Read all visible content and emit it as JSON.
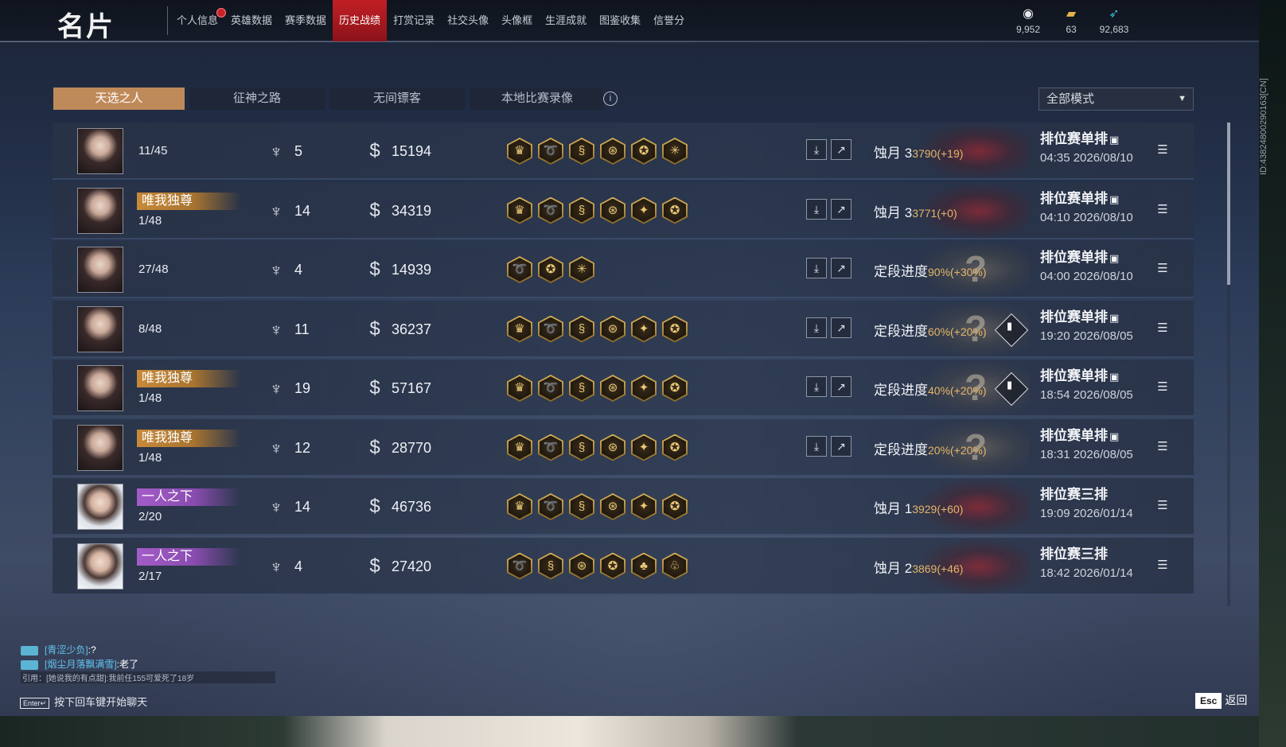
{
  "app": {
    "title": "名片"
  },
  "nav": {
    "items": [
      {
        "label": "个人信息",
        "badge": true
      },
      {
        "label": "英雄数据"
      },
      {
        "label": "赛季数据"
      },
      {
        "label": "历史战绩",
        "active": true
      },
      {
        "label": "打赏记录"
      },
      {
        "label": "社交头像"
      },
      {
        "label": "头像框"
      },
      {
        "label": "生涯成就"
      },
      {
        "label": "图鉴收集"
      },
      {
        "label": "信誉分"
      }
    ]
  },
  "currencies": [
    {
      "icon": "coin-eye-icon",
      "value": "9,952"
    },
    {
      "icon": "ticket-icon",
      "value": "63"
    },
    {
      "icon": "feather-icon",
      "value": "92,683"
    }
  ],
  "tabs": [
    {
      "label": "天选之人",
      "active": true
    },
    {
      "label": "征神之路"
    },
    {
      "label": "无间镖客"
    },
    {
      "label": "本地比赛录像"
    }
  ],
  "mode_filter": {
    "selected": "全部模式"
  },
  "side_id": "ID:4382480029016​3[CN]",
  "matches": [
    {
      "avatar": "female",
      "title": "",
      "title_style": "",
      "rank": "11/45",
      "kills": "5",
      "damage": "15194",
      "medals": [
        "♛",
        "➰",
        "§",
        "⊛",
        "✪",
        "✳"
      ],
      "replay": true,
      "result_label": "蚀月 3",
      "result_delta": "3790(+19)",
      "emblem": "red",
      "trend": false,
      "mode": "排位赛单排",
      "mode_icon": true,
      "time": "04:35  2026/08/10"
    },
    {
      "avatar": "female",
      "title": "唯我独尊",
      "title_style": "gold",
      "rank": "1/48",
      "kills": "14",
      "damage": "34319",
      "medals": [
        "♛",
        "➰",
        "§",
        "⊛",
        "✦",
        "✪"
      ],
      "replay": true,
      "result_label": "蚀月 3",
      "result_delta": "3771(+0)",
      "emblem": "red",
      "trend": false,
      "mode": "排位赛单排",
      "mode_icon": true,
      "time": "04:10  2026/08/10"
    },
    {
      "avatar": "female",
      "title": "",
      "title_style": "",
      "rank": "27/48",
      "kills": "4",
      "damage": "14939",
      "medals": [
        "➰",
        "✪",
        "✳"
      ],
      "replay": true,
      "result_label": "定段进度",
      "result_delta": "90%(+30%)",
      "emblem": "grey",
      "trend": false,
      "mode": "排位赛单排",
      "mode_icon": true,
      "time": "04:00  2026/08/10"
    },
    {
      "avatar": "female",
      "title": "",
      "title_style": "",
      "rank": "8/48",
      "kills": "11",
      "damage": "36237",
      "medals": [
        "♛",
        "➰",
        "§",
        "⊛",
        "✦",
        "✪"
      ],
      "replay": true,
      "result_label": "定段进度",
      "result_delta": "60%(+20%)",
      "emblem": "grey",
      "trend": true,
      "mode": "排位赛单排",
      "mode_icon": true,
      "time": "19:20  2026/08/05"
    },
    {
      "avatar": "female",
      "title": "唯我独尊",
      "title_style": "gold",
      "rank": "1/48",
      "kills": "19",
      "damage": "57167",
      "medals": [
        "♛",
        "➰",
        "§",
        "⊛",
        "✦",
        "✪"
      ],
      "replay": true,
      "result_label": "定段进度",
      "result_delta": "40%(+20%)",
      "emblem": "grey",
      "trend": true,
      "mode": "排位赛单排",
      "mode_icon": true,
      "time": "18:54  2026/08/05"
    },
    {
      "avatar": "female",
      "title": "唯我独尊",
      "title_style": "gold",
      "rank": "1/48",
      "kills": "12",
      "damage": "28770",
      "medals": [
        "♛",
        "➰",
        "§",
        "⊛",
        "✦",
        "✪"
      ],
      "replay": true,
      "result_label": "定段进度",
      "result_delta": "20%(+20%)",
      "emblem": "grey",
      "trend": false,
      "mode": "排位赛单排",
      "mode_icon": true,
      "time": "18:31  2026/08/05"
    },
    {
      "avatar": "male",
      "title": "一人之下",
      "title_style": "purple",
      "rank": "2/20",
      "kills": "14",
      "damage": "46736",
      "medals": [
        "♛",
        "➰",
        "§",
        "⊛",
        "✦",
        "✪"
      ],
      "replay": false,
      "result_label": "蚀月 1",
      "result_delta": "3929(+60)",
      "emblem": "red",
      "trend": false,
      "mode": "排位赛三排",
      "mode_icon": false,
      "time": "19:09  2026/01/14"
    },
    {
      "avatar": "male",
      "title": "一人之下",
      "title_style": "purple",
      "rank": "2/17",
      "kills": "4",
      "damage": "27420",
      "medals": [
        "➰",
        "§",
        "⊛",
        "✪",
        "♣",
        "♧"
      ],
      "replay": false,
      "result_label": "蚀月 2",
      "result_delta": "3869(+46)",
      "emblem": "red",
      "trend": false,
      "mode": "排位赛三排",
      "mode_icon": false,
      "time": "18:42  2026/01/14"
    }
  ],
  "chat": {
    "lines": [
      {
        "name": "[青涩少负]",
        "msg": ":?"
      },
      {
        "name": "[烟尘月落飘满雪]",
        "msg": ":老了"
      }
    ],
    "quote": "引用：[她说我的有点甜]:我前任155可爱死了18岁",
    "enter_key": "Enter↵",
    "enter_hint": "按下回车键开始聊天"
  },
  "esc": {
    "key": "Esc",
    "label": "返回"
  },
  "colors": {
    "accent_red": "#c21f26",
    "tab_active": "#bf8a5a",
    "delta_gold": "#e3b66a",
    "chat_name": "#63c3ef"
  }
}
